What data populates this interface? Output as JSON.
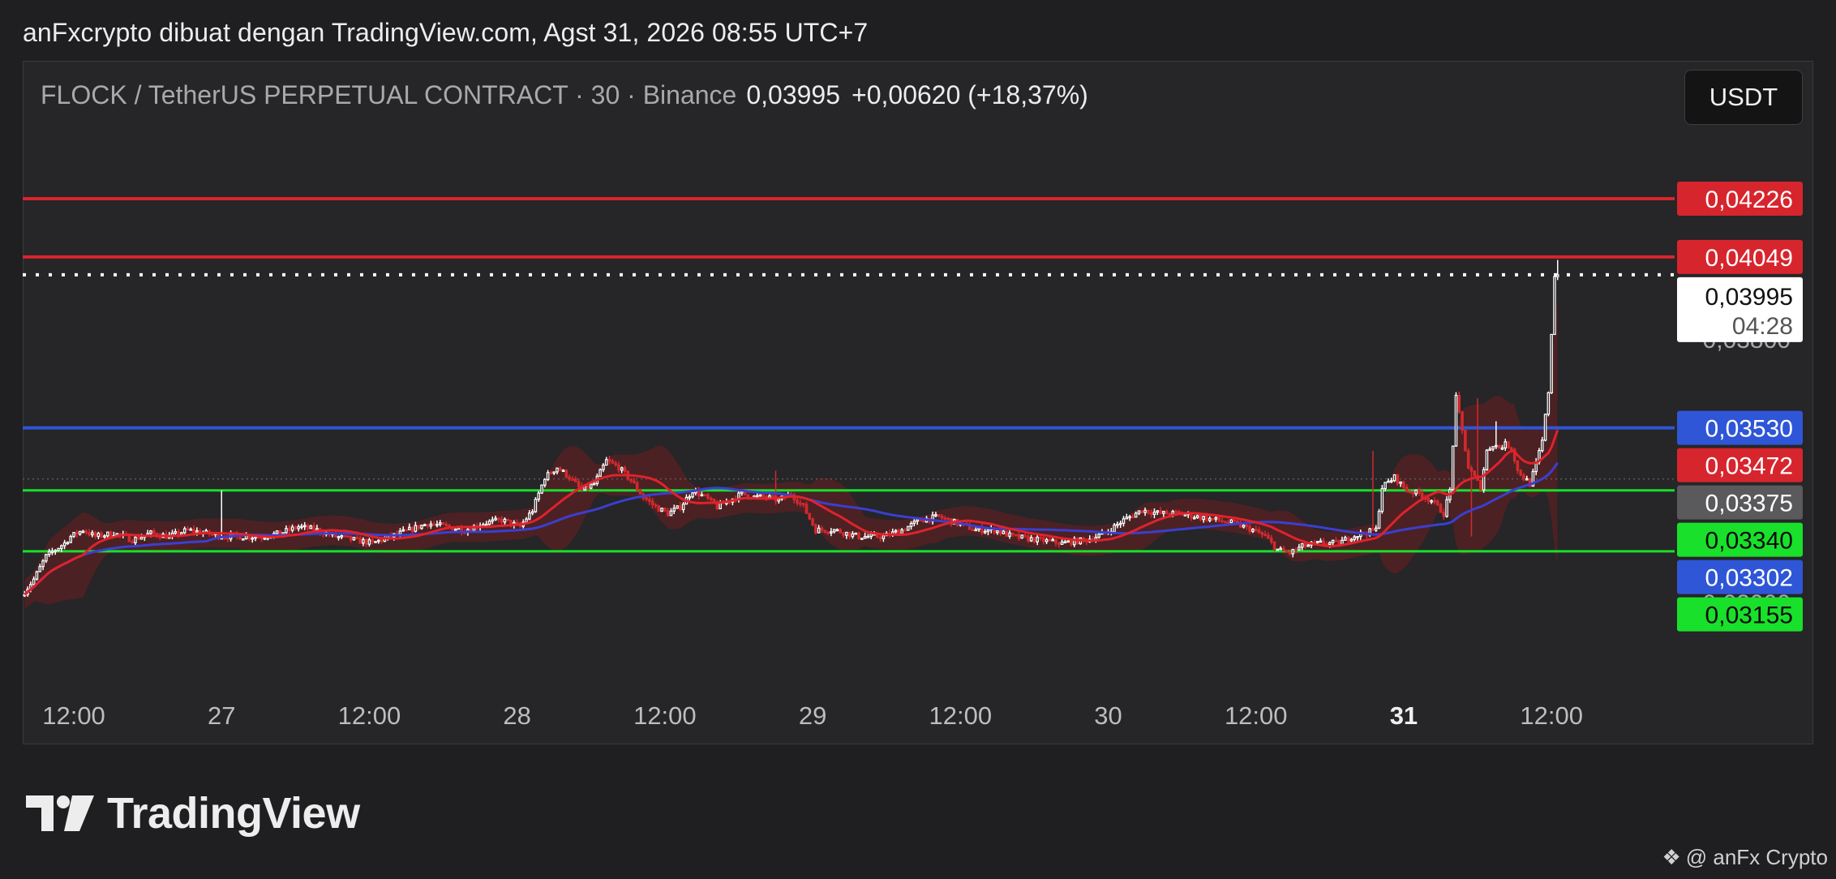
{
  "caption": "anFxcrypto dibuat dengan TradingView.com, Agst 31, 2026 08:55 UTC+7",
  "header": {
    "symbol": "FLOCK / TetherUS PERPETUAL CONTRACT · 30 · Binance",
    "price": "0,03995",
    "change": "+0,00620 (+18,37%)"
  },
  "currency_button": "USDT",
  "brand": {
    "wordmark": "TradingView"
  },
  "watermark": "@ anFx Crypto",
  "icons": {
    "logo": "tradingview-logo-icon",
    "watermark": "diamond-icon"
  },
  "colors": {
    "up": "#ffffff",
    "down": "#d22a2d",
    "resistance": "#d7252e",
    "mid_support": "#2f56d6",
    "support": "#19e02b",
    "ma_fast": "#e0222b",
    "ma_slow": "#3b3fcf"
  },
  "chart_data": {
    "type": "candlestick",
    "ylim": [
      0.0281,
      0.0446
    ],
    "x_ticks": [
      {
        "label": "12:00",
        "t": 0
      },
      {
        "label": "27",
        "t": 24
      },
      {
        "label": "12:00",
        "t": 48
      },
      {
        "label": "28",
        "t": 72
      },
      {
        "label": "12:00",
        "t": 96
      },
      {
        "label": "29",
        "t": 120
      },
      {
        "label": "12:00",
        "t": 144
      },
      {
        "label": "30",
        "t": 168
      },
      {
        "label": "12:00",
        "t": 192
      },
      {
        "label": "31",
        "t": 216,
        "bold": true
      },
      {
        "label": "12:00",
        "t": 240
      }
    ],
    "x_range_hours": [
      -8.3,
      260
    ],
    "price_ticks": [
      {
        "label": "0,03800",
        "value": 0.038
      },
      {
        "label": "0,03000",
        "value": 0.03
      }
    ],
    "horizontal_levels": [
      {
        "label": "0,04226",
        "value": 0.04226,
        "color": "#d7252e",
        "line": "solid"
      },
      {
        "label": "0,04049",
        "value": 0.04049,
        "color": "#d7252e",
        "line": "solid"
      },
      {
        "label": "0,03530",
        "value": 0.0353,
        "color": "#2f56d6",
        "line": "solid"
      },
      {
        "label": "0,03472",
        "value": 0.03472,
        "color": "#d7252e",
        "line": "none"
      },
      {
        "label": "0,03375",
        "value": 0.03375,
        "color": "#5a5a5c",
        "line": "dotted"
      },
      {
        "label": "0,03340",
        "value": 0.0334,
        "color": "#19e02b",
        "line": "solid"
      },
      {
        "label": "0,03302",
        "value": 0.03302,
        "color": "#2f56d6",
        "line": "none"
      },
      {
        "label": "0,03155",
        "value": 0.03155,
        "color": "#19e02b",
        "line": "solid"
      }
    ],
    "last_price": {
      "label": "0,03995",
      "countdown": "04:28",
      "value": 0.03995
    },
    "anchors": [
      [
        -8,
        0.0302
      ],
      [
        -6,
        0.0307
      ],
      [
        -4,
        0.0314
      ],
      [
        -1,
        0.0318
      ],
      [
        0,
        0.032
      ],
      [
        2,
        0.0322
      ],
      [
        4,
        0.032
      ],
      [
        7,
        0.0321
      ],
      [
        10,
        0.0319
      ],
      [
        13,
        0.0321
      ],
      [
        16,
        0.032
      ],
      [
        19,
        0.0322
      ],
      [
        22,
        0.0321
      ],
      [
        25,
        0.032
      ],
      [
        28,
        0.032
      ],
      [
        31,
        0.032
      ],
      [
        34,
        0.0321
      ],
      [
        37,
        0.0323
      ],
      [
        40,
        0.0322
      ],
      [
        43,
        0.032
      ],
      [
        46,
        0.0319
      ],
      [
        49,
        0.0318
      ],
      [
        52,
        0.032
      ],
      [
        55,
        0.0322
      ],
      [
        58,
        0.0324
      ],
      [
        61,
        0.0323
      ],
      [
        64,
        0.0322
      ],
      [
        67,
        0.0324
      ],
      [
        70,
        0.0325
      ],
      [
        73,
        0.0323
      ],
      [
        75,
        0.0328
      ],
      [
        77,
        0.0338
      ],
      [
        79,
        0.0341
      ],
      [
        81,
        0.0338
      ],
      [
        83,
        0.0334
      ],
      [
        85,
        0.0336
      ],
      [
        87,
        0.0343
      ],
      [
        89,
        0.0341
      ],
      [
        91,
        0.0337
      ],
      [
        93,
        0.0332
      ],
      [
        95,
        0.0329
      ],
      [
        97,
        0.0327
      ],
      [
        99,
        0.0329
      ],
      [
        101,
        0.0334
      ],
      [
        103,
        0.0332
      ],
      [
        105,
        0.0329
      ],
      [
        107,
        0.0331
      ],
      [
        109,
        0.0333
      ],
      [
        111,
        0.0332
      ],
      [
        113,
        0.0332
      ],
      [
        115,
        0.0331
      ],
      [
        117,
        0.0333
      ],
      [
        119,
        0.0329
      ],
      [
        121,
        0.0322
      ],
      [
        124,
        0.0322
      ],
      [
        128,
        0.032
      ],
      [
        132,
        0.032
      ],
      [
        135,
        0.0322
      ],
      [
        138,
        0.0325
      ],
      [
        141,
        0.0326
      ],
      [
        144,
        0.0324
      ],
      [
        147,
        0.0322
      ],
      [
        150,
        0.0322
      ],
      [
        153,
        0.032
      ],
      [
        157,
        0.0319
      ],
      [
        161,
        0.0318
      ],
      [
        165,
        0.0319
      ],
      [
        168,
        0.0321
      ],
      [
        171,
        0.0325
      ],
      [
        174,
        0.0328
      ],
      [
        177,
        0.0327
      ],
      [
        180,
        0.0327
      ],
      [
        183,
        0.0326
      ],
      [
        186,
        0.0325
      ],
      [
        189,
        0.0324
      ],
      [
        192,
        0.0322
      ],
      [
        194,
        0.032
      ],
      [
        196,
        0.0316
      ],
      [
        198,
        0.0315
      ],
      [
        200,
        0.0317
      ],
      [
        203,
        0.0318
      ],
      [
        206,
        0.0318
      ],
      [
        208,
        0.032
      ],
      [
        210,
        0.0321
      ],
      [
        212,
        0.0322
      ],
      [
        213,
        0.0335
      ],
      [
        215,
        0.0338
      ],
      [
        217,
        0.0334
      ],
      [
        219,
        0.0333
      ],
      [
        221,
        0.0331
      ],
      [
        223,
        0.0327
      ],
      [
        224,
        0.0334
      ],
      [
        225,
        0.0362
      ],
      [
        226,
        0.0352
      ],
      [
        227,
        0.0341
      ],
      [
        228,
        0.0338
      ],
      [
        229,
        0.0335
      ],
      [
        230,
        0.0346
      ],
      [
        231,
        0.0348
      ],
      [
        232,
        0.0347
      ],
      [
        233,
        0.0348
      ],
      [
        234,
        0.0347
      ],
      [
        235,
        0.034
      ],
      [
        236,
        0.0338
      ],
      [
        237,
        0.0336
      ],
      [
        238,
        0.0342
      ],
      [
        239,
        0.0349
      ],
      [
        240,
        0.0364
      ],
      [
        241,
        0.03995
      ]
    ],
    "spikes": [
      {
        "t": 24,
        "high": 0.0334
      },
      {
        "t": 114,
        "high": 0.034
      },
      {
        "t": 211,
        "high": 0.0346
      },
      {
        "t": 225,
        "high": 0.0364
      },
      {
        "t": 231,
        "high": 0.0355
      },
      {
        "t": 228,
        "high": 0.0362
      },
      {
        "t": 227,
        "low": 0.032
      },
      {
        "t": 241,
        "high": 0.0404
      }
    ]
  }
}
